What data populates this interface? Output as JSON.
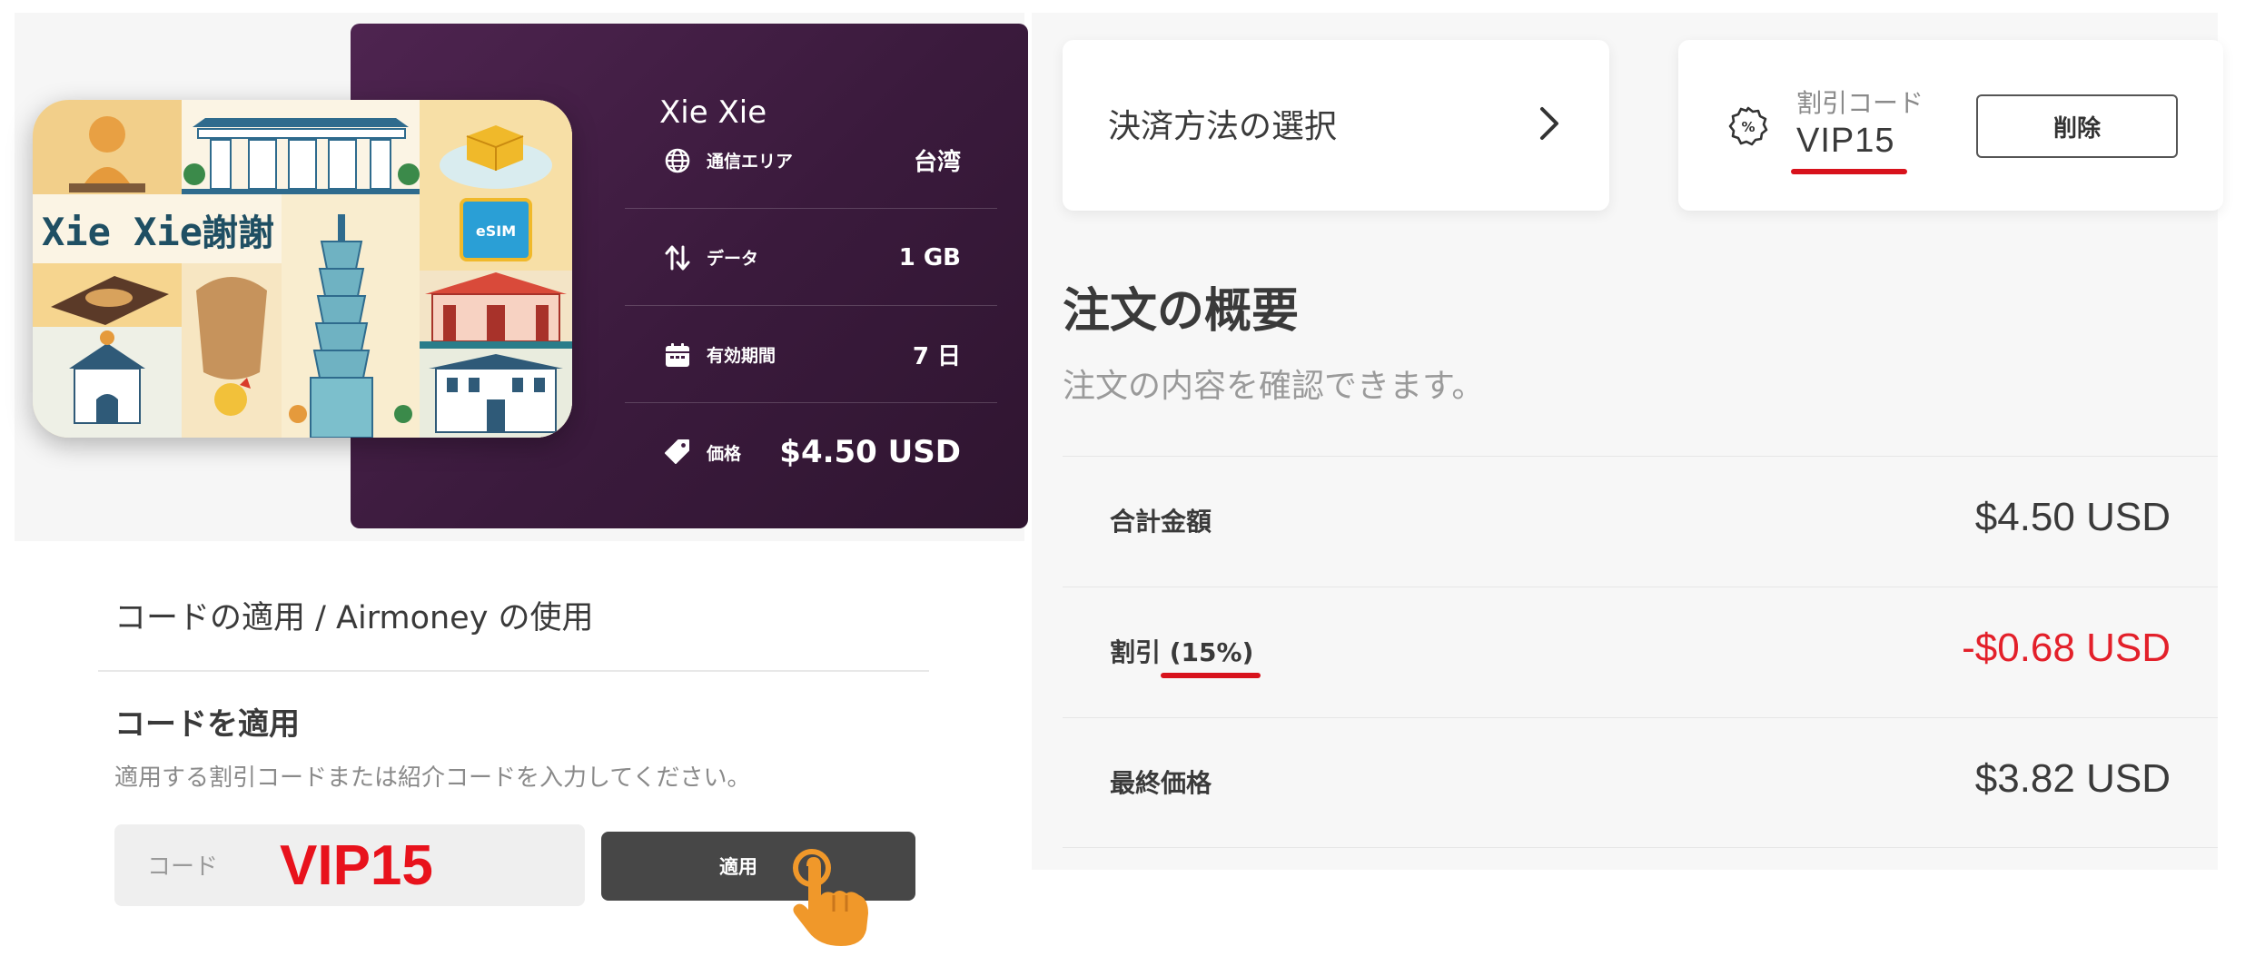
{
  "product": {
    "name": "Xie Xie",
    "specs": [
      {
        "icon": "globe-icon",
        "label": "通信エリア",
        "value": "台湾"
      },
      {
        "icon": "data-transfer-icon",
        "label": "データ",
        "value": "1 GB"
      },
      {
        "icon": "calendar-icon",
        "label": "有効期間",
        "value": "7 日"
      },
      {
        "icon": "price-tag-icon",
        "label": "価格",
        "value": "$4.50 USD"
      }
    ],
    "card_art": {
      "title_latin": "Xie Xie",
      "title_cjk": "謝謝",
      "chip_label": "eSIM"
    }
  },
  "apply_section": {
    "title": "コードの適用 / Airmoney の使用",
    "heading": "コードを適用",
    "description": "適用する割引コードまたは紹介コードを入力してください。",
    "input_placeholder": "コード",
    "input_value": "VIP15",
    "apply_button": "適用"
  },
  "payment": {
    "label": "決済方法の選択"
  },
  "discount": {
    "label": "割引コード",
    "code": "VIP15",
    "delete_button": "削除"
  },
  "summary": {
    "title": "注文の概要",
    "subtitle": "注文の内容を確認できます。",
    "rows": [
      {
        "label": "合計金額",
        "value": "$4.50 USD"
      },
      {
        "label": "割引 (15%)",
        "value": "-$0.68 USD"
      },
      {
        "label": "最終価格",
        "value": "$3.82 USD"
      }
    ]
  },
  "colors": {
    "card_purple": "#3f1c41",
    "accent_red": "#e3202a",
    "button_dark": "#474747",
    "pointer_orange": "#f0982a"
  }
}
